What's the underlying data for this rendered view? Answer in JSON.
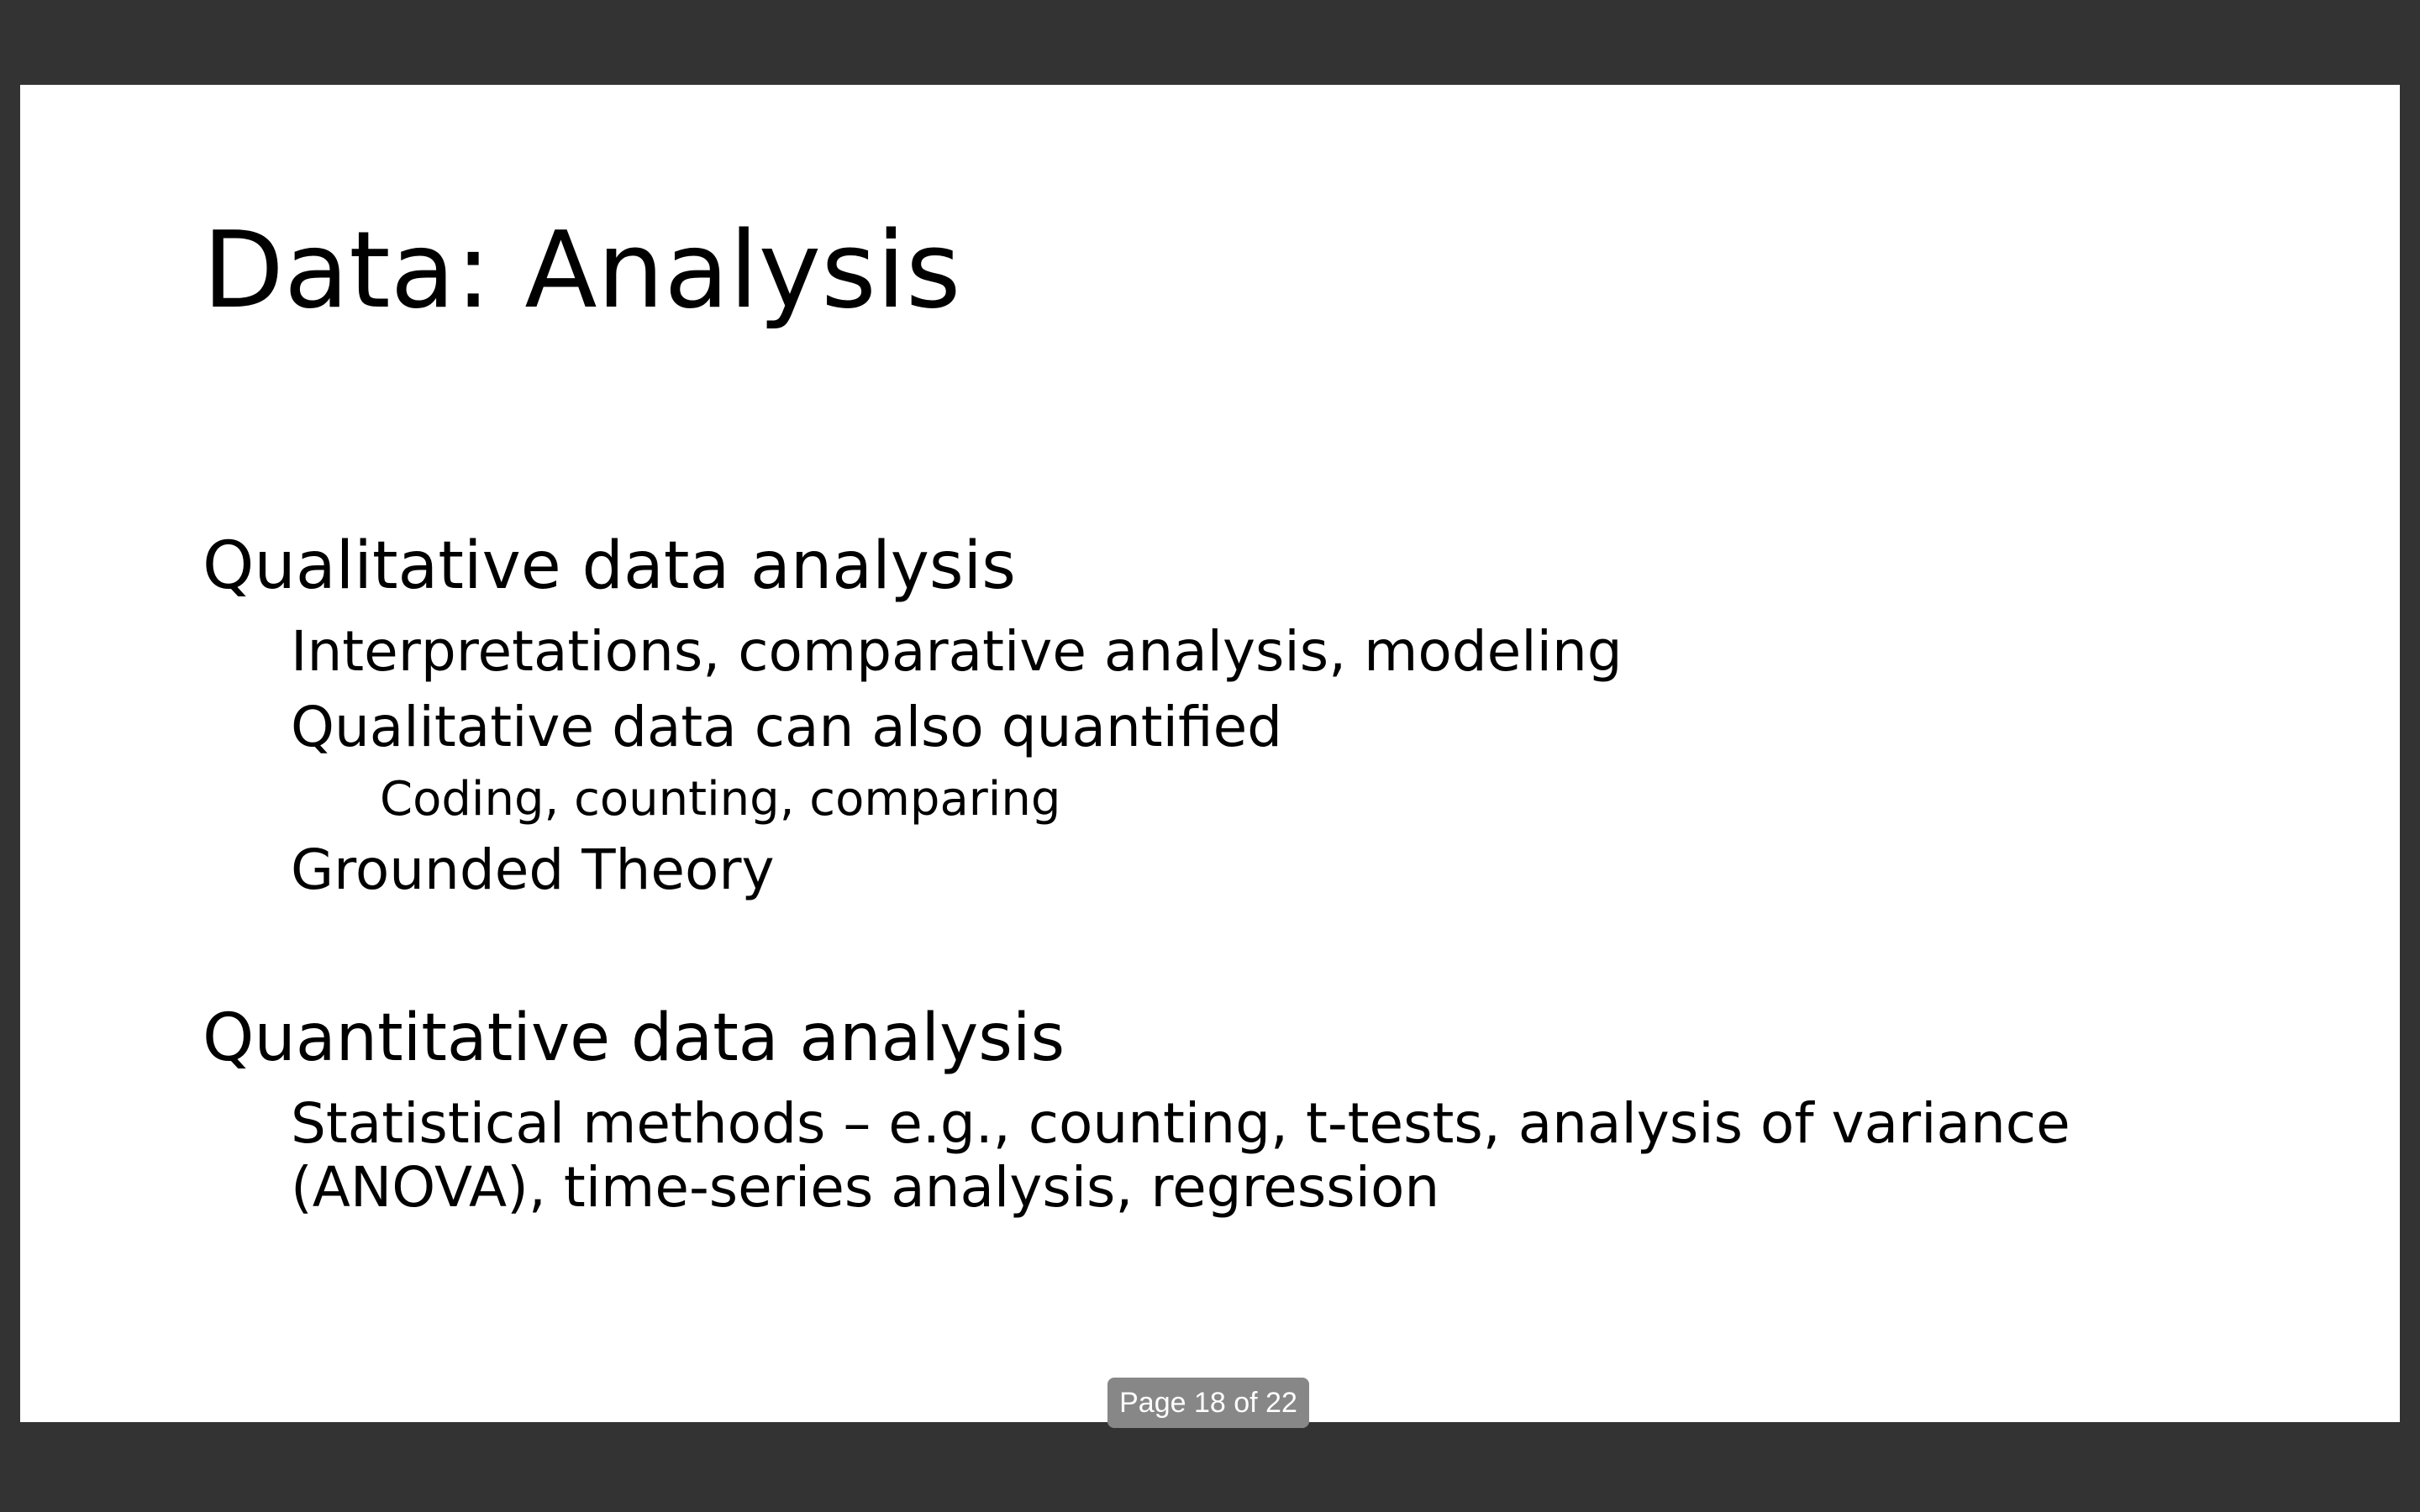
{
  "slide": {
    "title": "Data: Analysis",
    "sections": [
      {
        "heading": "Qualitative data analysis",
        "items": [
          {
            "text": "Interpretations, comparative analysis, modeling"
          },
          {
            "text": "Qualitative data can also quantified",
            "subitems": [
              "Coding, counting, comparing"
            ]
          },
          {
            "text": "Grounded Theory"
          }
        ]
      },
      {
        "heading": "Quantitative data analysis",
        "items": [
          {
            "text_lines": [
              "Statistical methods – e.g., counting, t-tests, analysis of variance",
              "(ANOVA), time-series analysis, regression"
            ]
          }
        ]
      }
    ]
  },
  "viewer": {
    "page_indicator": "Page 18 of 22"
  },
  "colors": {
    "viewer_background": "#333333",
    "slide_background": "#ffffff",
    "text": "#000000",
    "page_indicator_background": "#878787"
  }
}
